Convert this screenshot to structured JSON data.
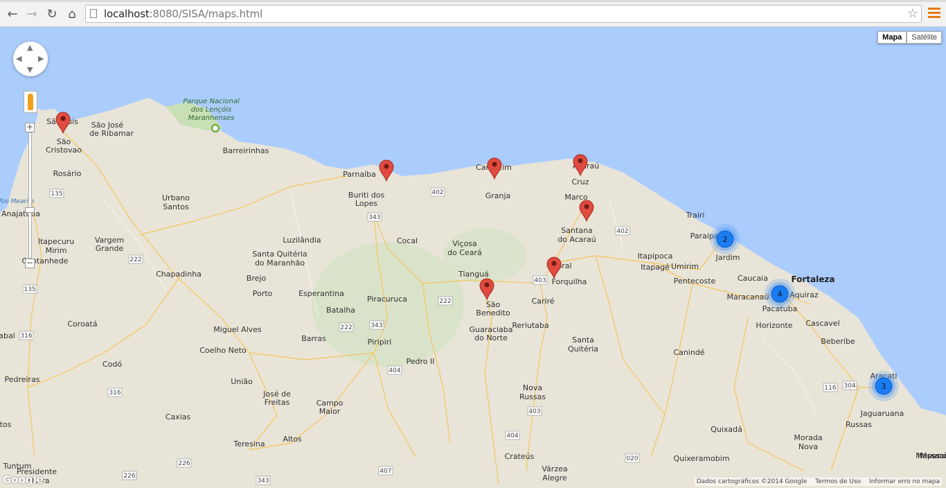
{
  "browser": {
    "back_icon": "←",
    "forward_icon": "→",
    "reload_icon": "↻",
    "home_icon": "⌂",
    "url_host": "localhost",
    "url_rest": ":8080/SISA/maps.html",
    "star_icon": "☆"
  },
  "map": {
    "type_buttons": [
      "Mapa",
      "Satélite"
    ],
    "active_type": "Mapa",
    "zoom_in": "+",
    "zoom_out": "−",
    "attribution": [
      "Dados cartográficos ©2014 Google",
      "Termos de Uso",
      "Informar erro no mapa"
    ],
    "logo": "Google",
    "park_label": [
      "Parque Nacional",
      "dos Lençóis",
      "Maranhenses"
    ],
    "water_label": "Rio Mearim",
    "big_city": "Fortaleza",
    "cities": [
      "São Luís",
      "São José",
      "de Ribamar",
      "São",
      "Cristovao",
      "Barreirinhas",
      "Rosário",
      "Urbano",
      "Santos",
      "Anajatuba",
      "Itapecuru",
      "Mirim",
      "Vargem",
      "Grande",
      "Cantanhede",
      "Chapadinha",
      "Parnaíba",
      "Buriti dos",
      "Lopes",
      "Luzilândia",
      "Santa Quitéria",
      "do Maranhão",
      "Brejo",
      "Porto",
      "Esperantina",
      "Batalha",
      "Piracuruca",
      "Cocal",
      "Viçosa",
      "do Ceará",
      "Tianguá",
      "São",
      "Benedito",
      "Guaraciaba",
      "do Norte",
      "Camocim",
      "Granja",
      "Acaraú",
      "Cruz",
      "Marco",
      "Santana",
      "do Acaraú",
      "Sobral",
      "Forquilha",
      "Cariré",
      "Reriutaba",
      "Santa",
      "Quitéria",
      "Itapipoca",
      "Itapagé",
      "Umirim",
      "Pentecoste",
      "Trairi",
      "Paraipaba",
      "Jardim",
      "Caucaia",
      "Maracanaú",
      "Pacatuba",
      "Aquiraz",
      "Horizonte",
      "Cascavel",
      "Beberibe",
      "Aracati",
      "Jaguaruana",
      "Russas",
      "Canindé",
      "Quixadá",
      "Morada",
      "Nova",
      "Quixeramobim",
      "Coroatá",
      "Miguel Alves",
      "Barras",
      "Piripiri",
      "Pedro II",
      "Coelho Neto",
      "Codó",
      "Pedreiras",
      "União",
      "José de",
      "Freitas",
      "Campo",
      "Maior",
      "Caxias",
      "Teresina",
      "Altos",
      "Tuntum",
      "Presidente",
      "Dutra",
      "Crateús",
      "Nova",
      "Russas",
      "Várzea",
      "Alegre",
      "Mossoró",
      "abal",
      "tos",
      "Itapecuru",
      "Mossoró"
    ],
    "highways": [
      "135",
      "135",
      "222",
      "316",
      "316",
      "222",
      "343",
      "402",
      "222",
      "222",
      "343",
      "403",
      "402",
      "404",
      "403",
      "404",
      "226",
      "226",
      "343",
      "407",
      "020",
      "116",
      "304"
    ],
    "markers_count": 8,
    "clusters": [
      {
        "label": "2",
        "count": 2
      },
      {
        "label": "4",
        "count": 4
      },
      {
        "label": "3",
        "count": 3
      }
    ]
  }
}
